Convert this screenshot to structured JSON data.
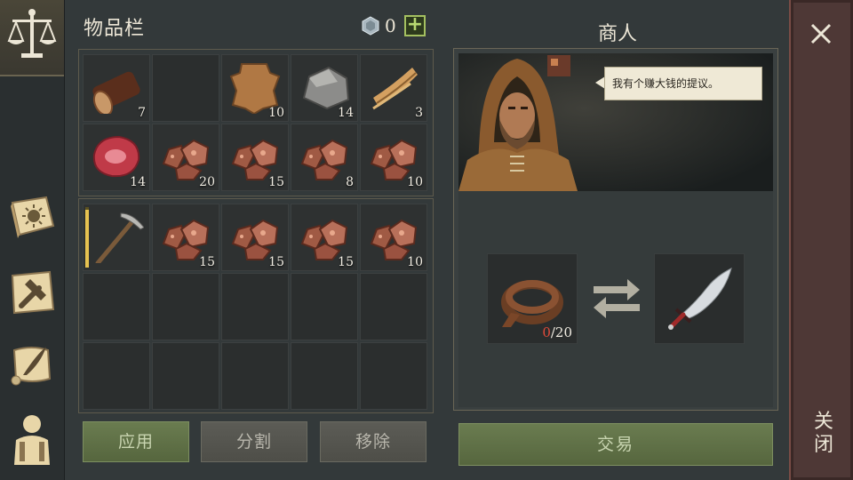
{
  "inventory": {
    "title": "物品栏",
    "currency_icon": "silver-gem-icon",
    "currency_amount": "0",
    "add_currency_label": "+",
    "bag_slots": [
      {
        "item": "log-icon",
        "qty": "7"
      },
      {
        "item": "",
        "qty": ""
      },
      {
        "item": "hide-icon",
        "qty": "10"
      },
      {
        "item": "stone-icon",
        "qty": "14"
      },
      {
        "item": "fiber-icon",
        "qty": "3"
      },
      {
        "item": "raw-meat-icon",
        "qty": "14"
      },
      {
        "item": "copper-ore-icon",
        "qty": "20"
      },
      {
        "item": "copper-ore-icon",
        "qty": "15"
      },
      {
        "item": "copper-ore-icon",
        "qty": "8"
      },
      {
        "item": "copper-ore-icon",
        "qty": "10"
      }
    ],
    "pack_slots": [
      {
        "item": "pickaxe-icon",
        "qty": "",
        "durability": 0.95
      },
      {
        "item": "copper-ore-icon",
        "qty": "15"
      },
      {
        "item": "copper-ore-icon",
        "qty": "15"
      },
      {
        "item": "copper-ore-icon",
        "qty": "15"
      },
      {
        "item": "copper-ore-icon",
        "qty": "10"
      }
    ],
    "buttons": {
      "apply": "应用",
      "split": "分割",
      "remove": "移除"
    }
  },
  "merchant": {
    "title": "商人",
    "speech": "我有个赚大钱的提议。",
    "give_item": "leather-strap-icon",
    "give_have": "0",
    "give_need": "/20",
    "receive_item": "scimitar-icon",
    "trade_label": "交易"
  },
  "close_label": "关闭",
  "colors": {
    "accent_green": "#6a7c50",
    "close_panel": "#4e3836",
    "missing_red": "#e04a3a"
  }
}
